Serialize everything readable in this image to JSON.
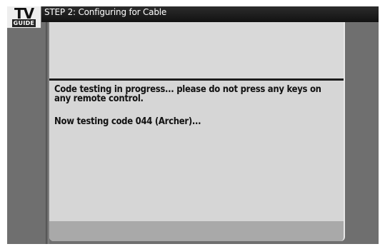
{
  "header": {
    "title": "STEP 2: Configuring for Cable",
    "logo": {
      "line1": "TV",
      "line2": "GUIDE"
    }
  },
  "content": {
    "message": "Code testing in progress... please do not press any keys on any remote control.",
    "status": "Now testing code 044 (Archer)..."
  }
}
